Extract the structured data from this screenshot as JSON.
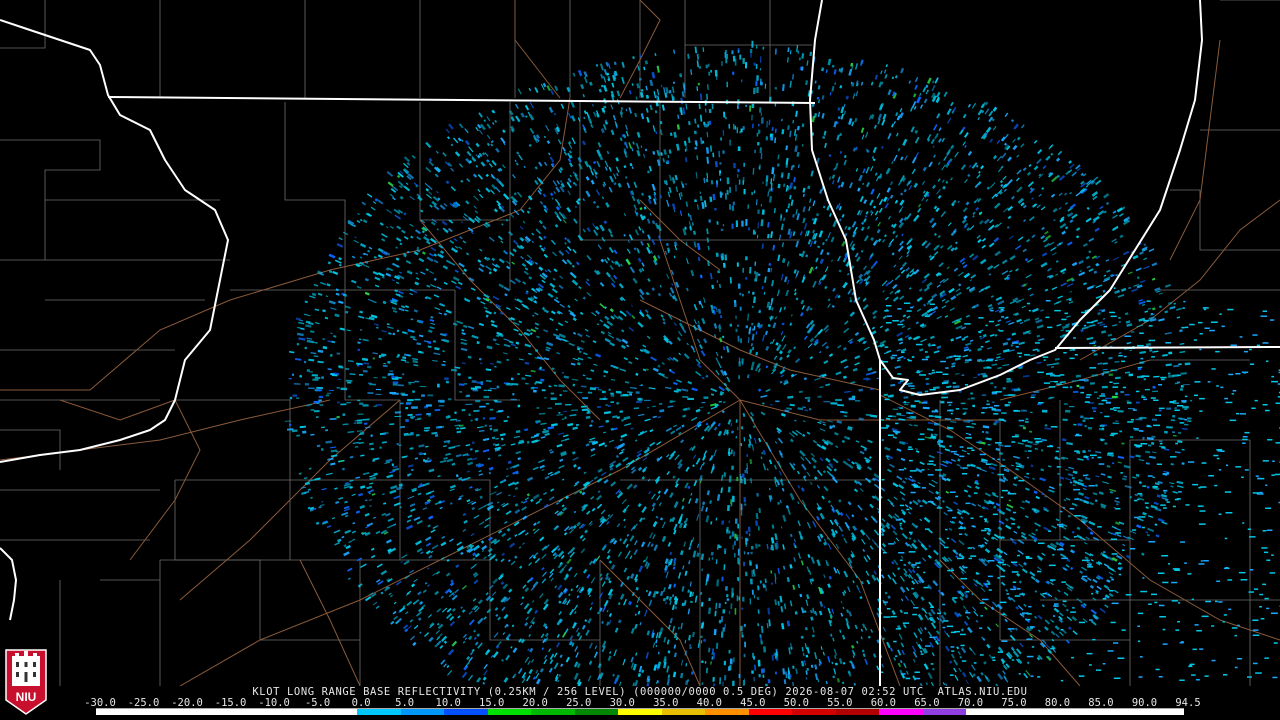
{
  "map": {
    "radar_site": "KLOT",
    "product": "LONG RANGE BASE REFLECTIVITY",
    "title_line": "KLOT LONG RANGE BASE REFLECTIVITY (0.25KM / 256 LEVEL) (000000/0000 0.5 DEG) 2026-08-07 02:52 UTC  ATLAS.NIU.EDU",
    "echo_colors": [
      "#00c8e8",
      "#1aa8ff",
      "#0a64ff",
      "#00a8c8",
      "#28d848"
    ],
    "border_color": "#ffffff",
    "county_line_color": "#6e6e6e",
    "road_color": "#8a5a3a"
  },
  "legend": {
    "ticks": [
      "-30.0",
      "-25.0",
      "-20.0",
      "-15.0",
      "-10.0",
      "-5.0",
      "0.0",
      "5.0",
      "10.0",
      "15.0",
      "20.0",
      "25.0",
      "30.0",
      "35.0",
      "40.0",
      "45.0",
      "50.0",
      "55.0",
      "60.0",
      "65.0",
      "70.0",
      "75.0",
      "80.0",
      "85.0",
      "90.0",
      "94.5"
    ],
    "colors": [
      "#ffffff",
      "#ffffff",
      "#ffffff",
      "#ffffff",
      "#ffffff",
      "#ffffff",
      "#00c8ff",
      "#0098f8",
      "#0050ff",
      "#00e000",
      "#00b800",
      "#008800",
      "#ffff00",
      "#e8c000",
      "#ff9000",
      "#ff0000",
      "#d00000",
      "#b00000",
      "#ff00ff",
      "#9040e0",
      "#ffffff",
      "#ffffff",
      "#ffffff",
      "#ffffff",
      "#ffffff"
    ]
  },
  "logo": {
    "text": "NIU"
  }
}
